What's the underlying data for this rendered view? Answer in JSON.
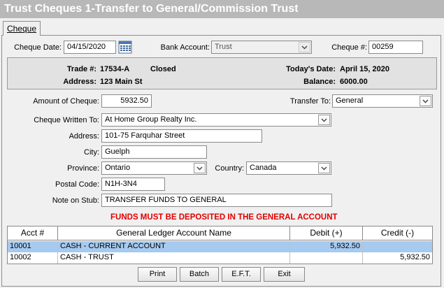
{
  "window": {
    "title": "Trust Cheques 1-Transfer to General/Commission Trust"
  },
  "tabs": [
    {
      "label": "Cheque"
    }
  ],
  "header": {
    "cheque_date_label": "Cheque Date:",
    "cheque_date_value": "04/15/2020",
    "bank_account_label": "Bank Account:",
    "bank_account_value": "Trust",
    "cheque_no_label": "Cheque #:",
    "cheque_no_value": "00259"
  },
  "info": {
    "trade_label": "Trade #:",
    "trade_value": "17534-A",
    "trade_status": "Closed",
    "address_label": "Address:",
    "address_value": "123 Main St",
    "today_label": "Today's Date:",
    "today_value": "April 15, 2020",
    "balance_label": "Balance:",
    "balance_value": "6000.00"
  },
  "form": {
    "amount_label": "Amount of Cheque:",
    "amount_value": "5932.50",
    "transfer_to_label": "Transfer To:",
    "transfer_to_value": "General",
    "written_to_label": "Cheque Written To:",
    "written_to_value": "At Home Group Realty Inc.",
    "address_label": "Address:",
    "address_value": "101-75 Farquhar Street",
    "city_label": "City:",
    "city_value": "Guelph",
    "province_label": "Province:",
    "province_value": "Ontario",
    "country_label": "Country:",
    "country_value": "Canada",
    "postal_label": "Postal Code:",
    "postal_value": "N1H-3N4",
    "stub_label": "Note on Stub:",
    "stub_value": "TRANSFER FUNDS TO GENERAL"
  },
  "warning": "FUNDS MUST BE DEPOSITED IN THE GENERAL ACCOUNT",
  "ledger": {
    "columns": [
      "Acct #",
      "General Ledger Account Name",
      "Debit (+)",
      "Credit (-)"
    ],
    "rows": [
      {
        "acct": "10001",
        "name": "CASH - CURRENT ACCOUNT",
        "debit": "5,932.50",
        "credit": ""
      },
      {
        "acct": "10002",
        "name": "CASH - TRUST",
        "debit": "",
        "credit": "5,932.50"
      }
    ]
  },
  "buttons": {
    "print": "Print",
    "batch": "Batch",
    "eft": "E.F.T.",
    "exit": "Exit"
  },
  "colors": {
    "title_bar": "#b8b8b8",
    "warning": "#e00000",
    "selected_row": "#a6caf0"
  }
}
